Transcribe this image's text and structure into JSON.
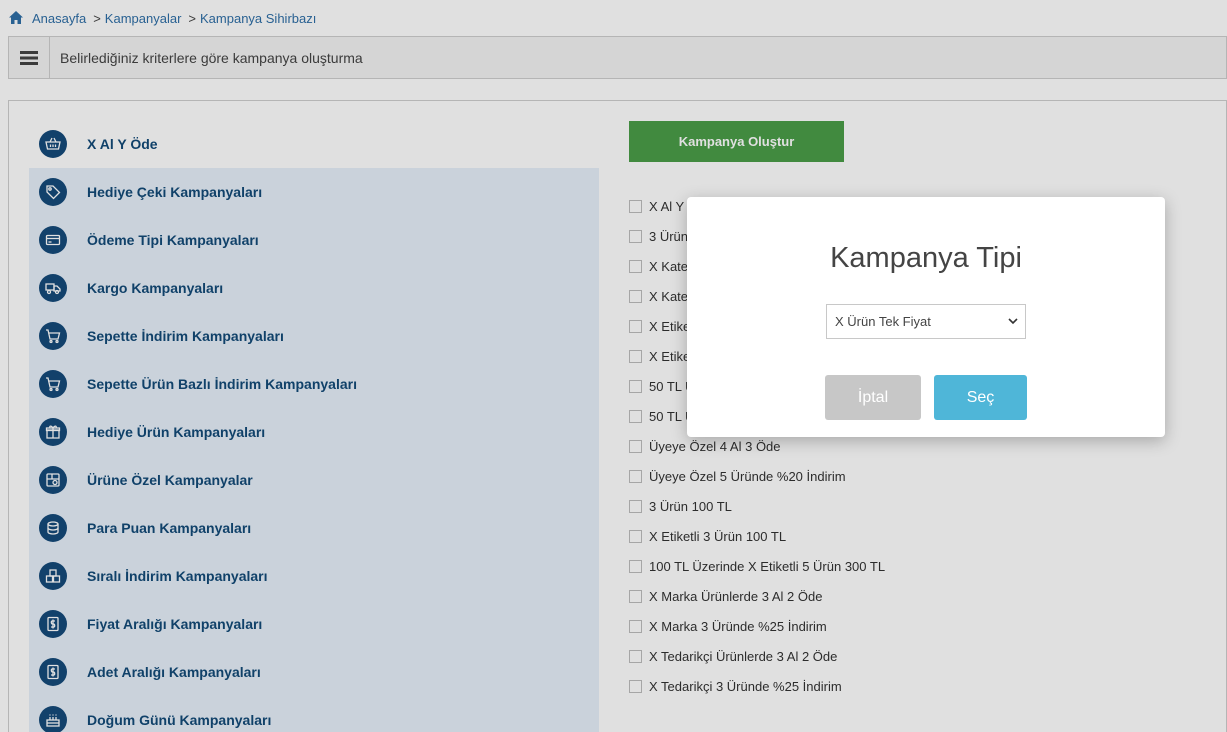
{
  "breadcrumb": {
    "home": "Anasayfa",
    "campaigns": "Kampanyalar",
    "wizard": "Kampanya Sihirbazı",
    "separator": ">"
  },
  "header": {
    "title": "Belirlediğiniz kriterlere göre kampanya oluşturma"
  },
  "campaign_types": [
    {
      "label": "X Al Y Öde",
      "icon": "basket-icon"
    },
    {
      "label": "Hediye Çeki Kampanyaları",
      "icon": "tag-icon"
    },
    {
      "label": "Ödeme Tipi Kampanyaları",
      "icon": "credit-card-icon"
    },
    {
      "label": "Kargo Kampanyaları",
      "icon": "truck-icon"
    },
    {
      "label": "Sepette İndirim Kampanyaları",
      "icon": "cart-icon"
    },
    {
      "label": "Sepette Ürün Bazlı İndirim Kampanyaları",
      "icon": "cart-icon"
    },
    {
      "label": "Hediye Ürün Kampanyaları",
      "icon": "gift-icon"
    },
    {
      "label": "Ürüne Özel Kampanyalar",
      "icon": "product-icon"
    },
    {
      "label": "Para Puan Kampanyaları",
      "icon": "coins-icon"
    },
    {
      "label": "Sıralı İndirim Kampanyaları",
      "icon": "boxes-icon"
    },
    {
      "label": "Fiyat Aralığı Kampanyaları",
      "icon": "price-icon"
    },
    {
      "label": "Adet Aralığı Kampanyaları",
      "icon": "price-icon"
    },
    {
      "label": "Doğum Günü Kampanyaları",
      "icon": "cake-icon"
    }
  ],
  "create_button": "Kampanya Oluştur",
  "templates": [
    "X Al Y",
    "3 Ürün",
    "X Kate",
    "X Kate",
    "X Etike",
    "X Etike",
    "50 TL Ü",
    "50 TL Ü",
    "Üyeye Özel 4 Al 3 Öde",
    "Üyeye Özel 5 Üründe %20 İndirim",
    "3 Ürün 100 TL",
    "X Etiketli 3 Ürün 100 TL",
    "100 TL Üzerinde X Etiketli 5 Ürün 300 TL",
    "X Marka Ürünlerde 3 Al 2 Öde",
    "X Marka 3 Üründe %25 İndirim",
    "X Tedarikçi Ürünlerde 3 Al 2 Öde",
    "X Tedarikçi 3 Üründe %25 İndirim"
  ],
  "modal": {
    "title": "Kampanya Tipi",
    "selected_option": "X Ürün Tek Fiyat",
    "cancel_label": "İptal",
    "select_label": "Seç"
  },
  "colors": {
    "accent": "#154a7a",
    "create": "#4a9e48",
    "select": "#4fb6d8",
    "cancel": "#c7c7c7"
  }
}
